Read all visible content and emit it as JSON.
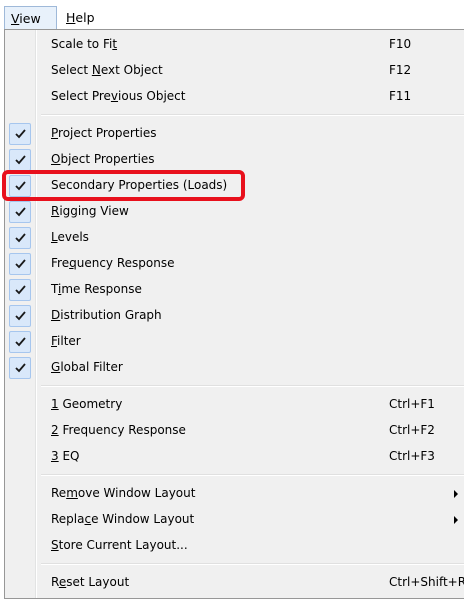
{
  "menubar": {
    "view": {
      "accel": "V",
      "rest": "iew"
    },
    "help": {
      "accel": "H",
      "rest": "elp"
    }
  },
  "groups": [
    [
      {
        "pre": "Scale to Fi",
        "accel": "t",
        "post": "",
        "shortcut": "F10",
        "checked": false
      },
      {
        "pre": "Select ",
        "accel": "N",
        "post": "ext Object",
        "shortcut": "F12",
        "checked": false
      },
      {
        "pre": "Select Pre",
        "accel": "v",
        "post": "ious Object",
        "shortcut": "F11",
        "checked": false
      }
    ],
    [
      {
        "pre": "",
        "accel": "P",
        "post": "roject Properties",
        "shortcut": "",
        "checked": true
      },
      {
        "pre": "",
        "accel": "O",
        "post": "bject Properties",
        "shortcut": "",
        "checked": true
      },
      {
        "pre": "Secondary Properties (Loads)",
        "accel": "",
        "post": "",
        "shortcut": "",
        "checked": true
      },
      {
        "pre": "",
        "accel": "R",
        "post": "igging View",
        "shortcut": "",
        "checked": true
      },
      {
        "pre": "",
        "accel": "L",
        "post": "evels",
        "shortcut": "",
        "checked": true
      },
      {
        "pre": "Fre",
        "accel": "q",
        "post": "uency Response",
        "shortcut": "",
        "checked": true
      },
      {
        "pre": "T",
        "accel": "i",
        "post": "me Response",
        "shortcut": "",
        "checked": true
      },
      {
        "pre": "",
        "accel": "D",
        "post": "istribution Graph",
        "shortcut": "",
        "checked": true
      },
      {
        "pre": "",
        "accel": "F",
        "post": "ilter",
        "shortcut": "",
        "checked": true
      },
      {
        "pre": "",
        "accel": "G",
        "post": "lobal Filter",
        "shortcut": "",
        "checked": true
      }
    ],
    [
      {
        "pre": "",
        "accel": "1",
        "post": " Geometry",
        "shortcut": "Ctrl+F1",
        "checked": false
      },
      {
        "pre": "",
        "accel": "2",
        "post": " Frequency Response",
        "shortcut": "Ctrl+F2",
        "checked": false
      },
      {
        "pre": "",
        "accel": "3",
        "post": " EQ",
        "shortcut": "Ctrl+F3",
        "checked": false
      }
    ],
    [
      {
        "pre": "Re",
        "accel": "m",
        "post": "ove Window Layout",
        "shortcut": "",
        "checked": false,
        "submenu": true
      },
      {
        "pre": "Repla",
        "accel": "c",
        "post": "e Window Layout",
        "shortcut": "",
        "checked": false,
        "submenu": true
      },
      {
        "pre": "",
        "accel": "S",
        "post": "tore Current Layout...",
        "shortcut": "",
        "checked": false
      }
    ],
    [
      {
        "pre": "R",
        "accel": "e",
        "post": "set Layout",
        "shortcut": "Ctrl+Shift+R",
        "checked": false
      }
    ]
  ],
  "colors": {
    "highlight_box": "#e8101c",
    "check_bg": "#d9e8fa",
    "menu_bg": "#f0f0f0"
  },
  "icons": {
    "check": "checkmark-icon",
    "submenu": "submenu-arrow-icon"
  }
}
